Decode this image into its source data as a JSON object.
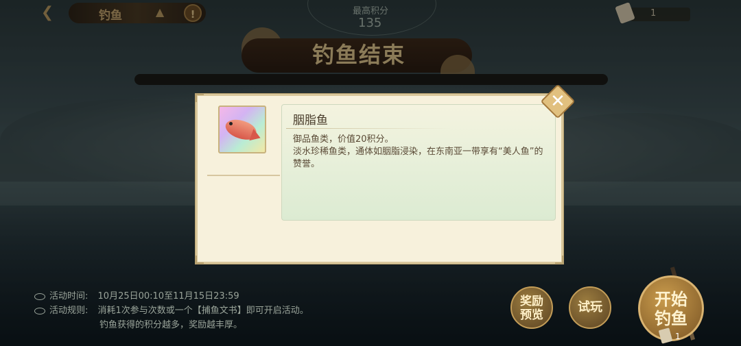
{
  "header": {
    "title": "钓鱼",
    "max_score_label": "最高积分",
    "max_score_value": "135",
    "ticket_count": "1"
  },
  "banner": {
    "title": "钓鱼结束"
  },
  "modal": {
    "fish_name": "胭脂鱼",
    "desc_line1": "御品鱼类，价值20积分。",
    "desc_line2": "淡水珍稀鱼类，通体如胭脂浸染，在东南亚一带享有“美人鱼”的赞誉。",
    "close_icon": "close-icon"
  },
  "info": {
    "time_label": "活动时间:",
    "time_value": "10月25日00:10至11月15日23:59",
    "rule_label": "活动规则:",
    "rule_value": "消耗1次参与次数或一个【捕鱼文书】即可开启活动。",
    "rule_value2": "钓鱼获得的积分越多，奖励越丰厚。"
  },
  "buttons": {
    "reward_preview": "奖励预览",
    "trial": "试玩",
    "start": "开始钓鱼",
    "start_count": "1"
  },
  "colors": {
    "accent_gold": "#e1c07f",
    "modal_bg": "#f7f1dc",
    "desc_text": "#5a4a36"
  }
}
